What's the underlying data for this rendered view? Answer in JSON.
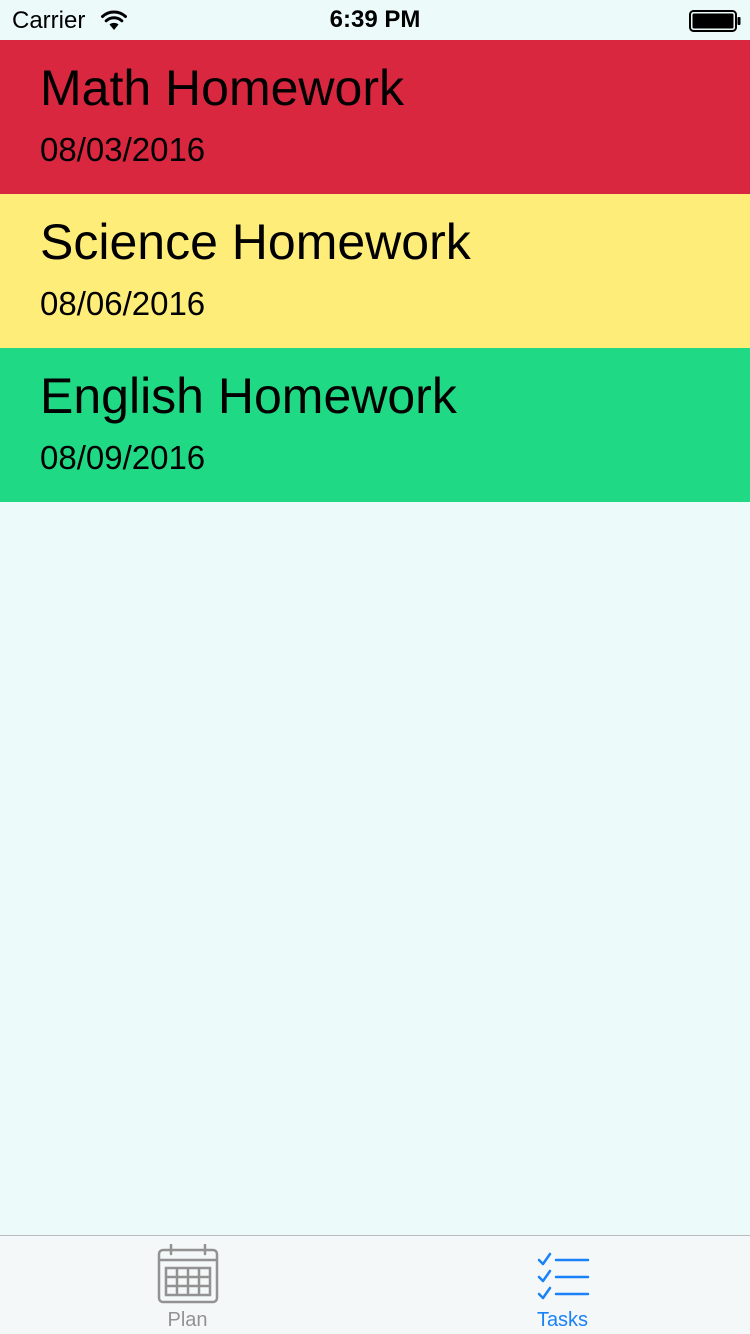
{
  "status_bar": {
    "carrier": "Carrier",
    "time": "6:39 PM",
    "signal_icon": "wifi-icon",
    "battery_icon": "battery-icon"
  },
  "tasks": [
    {
      "title": "Math Homework",
      "date": "08/03/2016",
      "color": "#d8273f"
    },
    {
      "title": "Science Homework",
      "date": "08/06/2016",
      "color": "#ffed79"
    },
    {
      "title": "English Homework",
      "date": "08/09/2016",
      "color": "#1fd984"
    }
  ],
  "tab_bar": {
    "selected": "Tasks",
    "tabs": [
      {
        "label": "Plan",
        "icon": "calendar-icon"
      },
      {
        "label": "Tasks",
        "icon": "checklist-icon"
      }
    ]
  },
  "colors": {
    "background": "#ecfbf9",
    "accent": "#1a82f7",
    "inactive_tab": "#929292"
  }
}
